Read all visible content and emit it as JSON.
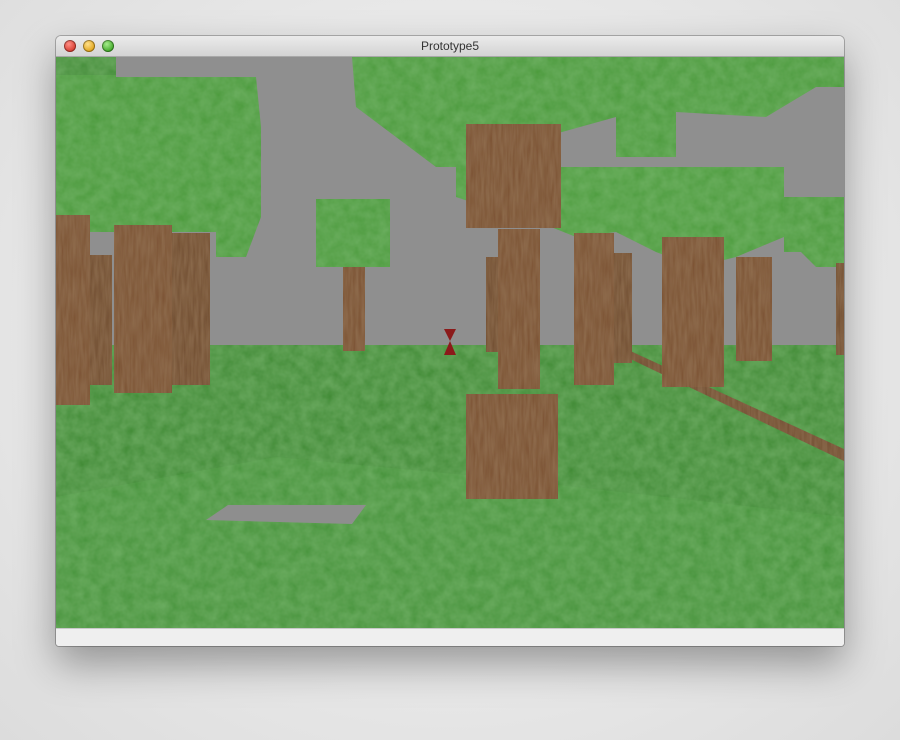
{
  "window": {
    "title": "Prototype5"
  },
  "scene": {
    "sky_color": "#8f8f8f",
    "grass_color": "#3f8a33",
    "leaf_color": "#4a9a3a",
    "bark_color": "#7a5030",
    "crosshair_color": "#8b1a1a",
    "crosshair_shape": "hourglass"
  }
}
